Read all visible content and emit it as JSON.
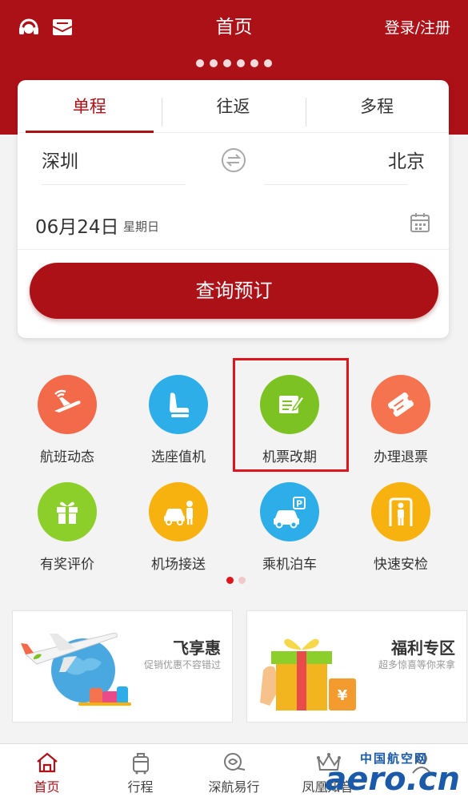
{
  "header": {
    "title": "首页",
    "login_label": "登录/注册",
    "brand_color": "#ad1118",
    "left_icons": [
      "headset-icon",
      "mail-icon"
    ]
  },
  "booking": {
    "tabs": [
      {
        "label": "单程",
        "active": true
      },
      {
        "label": "往返",
        "active": false
      },
      {
        "label": "多程",
        "active": false
      }
    ],
    "from_city": "深圳",
    "to_city": "北京",
    "date": "06月24日",
    "weekday": "星期日",
    "search_label": "查询预订"
  },
  "services": [
    {
      "label": "航班动态",
      "icon": "plane-takeoff-icon",
      "color": "#f36a4a"
    },
    {
      "label": "选座值机",
      "icon": "seat-icon",
      "color": "#2daee8"
    },
    {
      "label": "机票改期",
      "icon": "edit-ticket-icon",
      "color": "#7cc222"
    },
    {
      "label": "办理退票",
      "icon": "refund-ticket-icon",
      "color": "#f5734f"
    },
    {
      "label": "有奖评价",
      "icon": "gift-icon",
      "color": "#8ccf2a"
    },
    {
      "label": "机场接送",
      "icon": "car-driver-icon",
      "color": "#f7b20f"
    },
    {
      "label": "乘机泊车",
      "icon": "parking-icon",
      "color": "#2daee8"
    },
    {
      "label": "快速安检",
      "icon": "security-check-icon",
      "color": "#f7b20f"
    }
  ],
  "promos": [
    {
      "title": "飞享惠",
      "subtitle": "促销优惠不容错过"
    },
    {
      "title": "福利专区",
      "subtitle": "超多惊喜等你来拿"
    }
  ],
  "tabbar": [
    {
      "label": "首页",
      "icon": "home-icon",
      "active": true
    },
    {
      "label": "行程",
      "icon": "luggage-icon",
      "active": false
    },
    {
      "label": "深航易行",
      "icon": "easy-travel-icon",
      "active": false
    },
    {
      "label": "凤凰知音",
      "icon": "crown-icon",
      "active": false
    }
  ],
  "watermark": {
    "cn": "中国航空网",
    "en": "aero.cn"
  }
}
